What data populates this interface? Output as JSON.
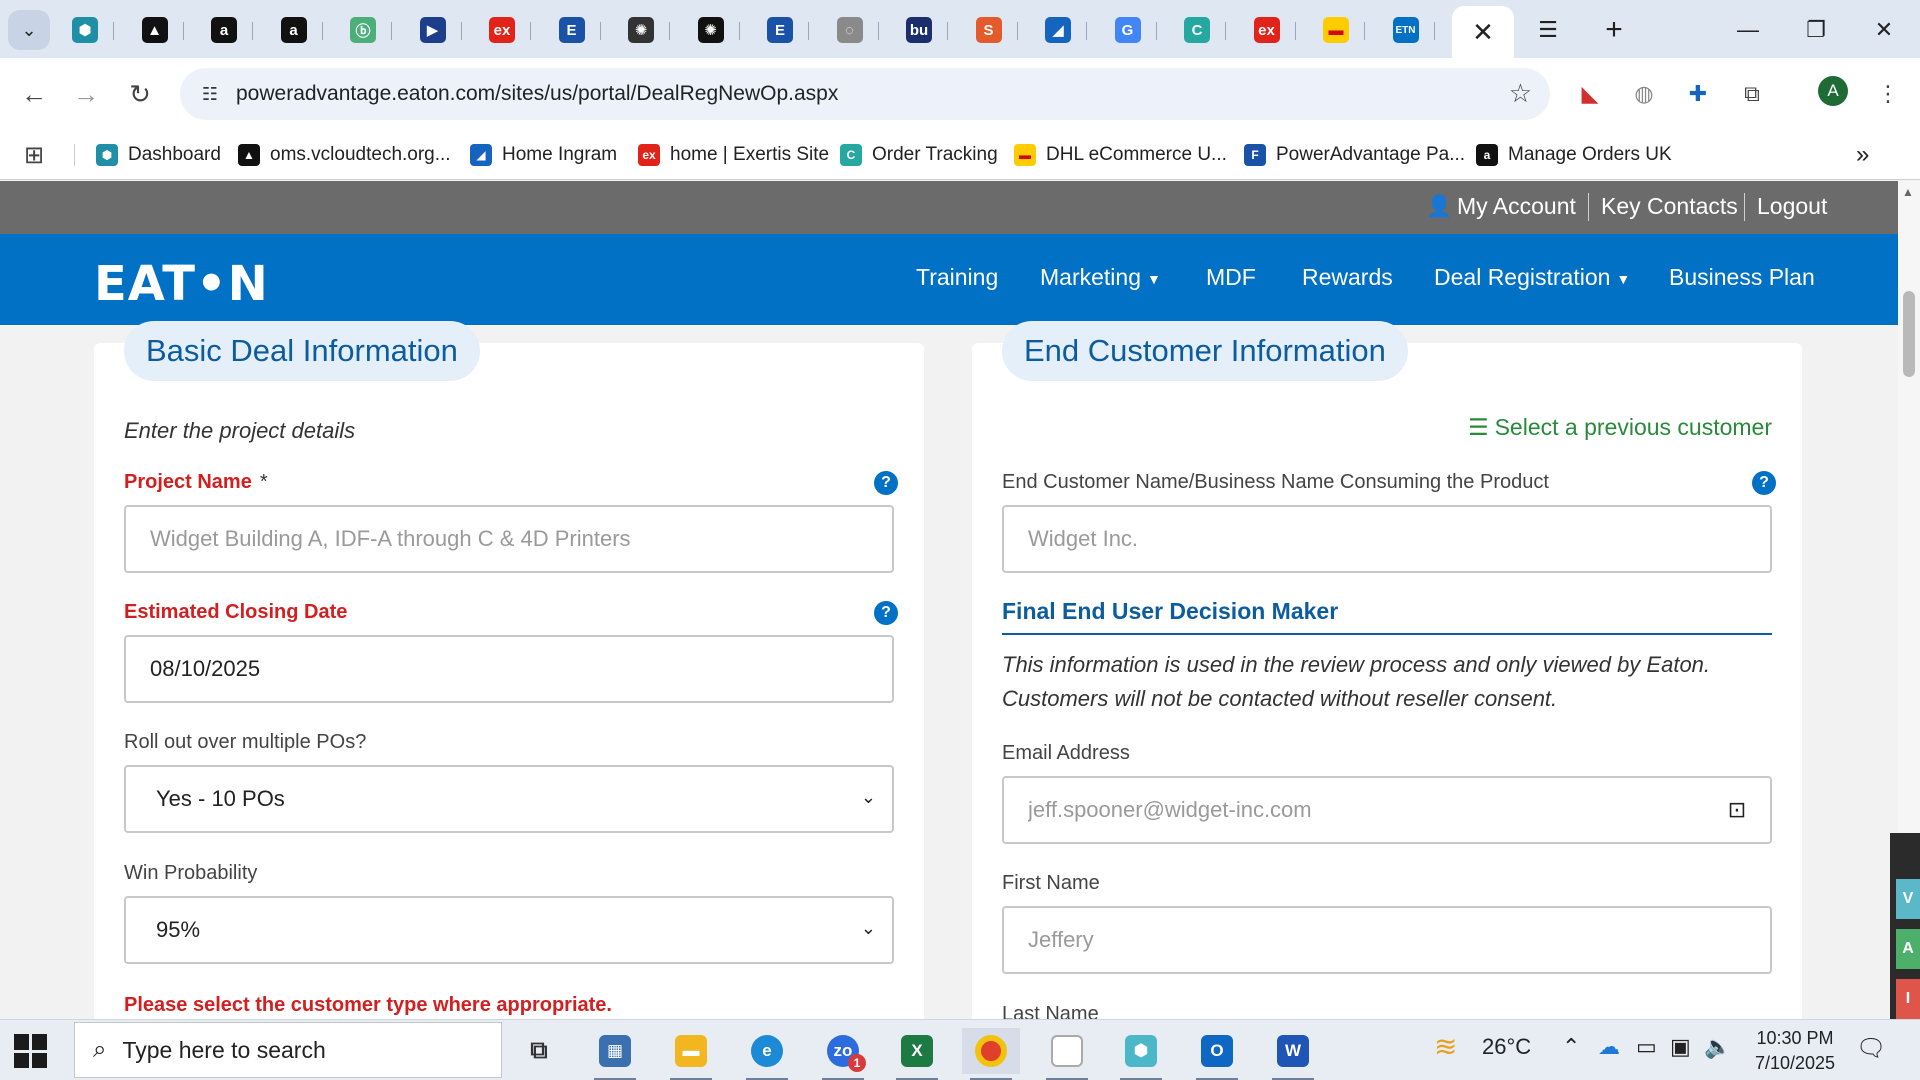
{
  "browser": {
    "active_tab_close": "✕",
    "pinned_tabs": [
      {
        "icon": "hexagon-icon",
        "glyph": "⬢",
        "color": "#1f8fa8",
        "text_color": "#ffffff"
      },
      {
        "icon": "triangle-logo-icon",
        "glyph": "▲",
        "color": "#111111",
        "text_color": "#ffffff"
      },
      {
        "icon": "amazon-icon",
        "glyph": "a",
        "color": "#111111",
        "text_color": "#ffffff"
      },
      {
        "icon": "amazon-icon",
        "glyph": "a",
        "color": "#111111",
        "text_color": "#ffffff"
      },
      {
        "icon": "green-bolt-icon",
        "glyph": "ⓑ",
        "color": "#4caf7a",
        "text_color": "#ffffff"
      },
      {
        "icon": "arrow-play-icon",
        "glyph": "▶",
        "color": "#1d3e8a",
        "text_color": "#ffffff"
      },
      {
        "icon": "exertis-icon",
        "glyph": "ex",
        "color": "#e2231a",
        "text_color": "#ffffff"
      },
      {
        "icon": "e-logo-icon",
        "glyph": "E",
        "color": "#1a52a8",
        "text_color": "#ffffff"
      },
      {
        "icon": "openai-icon",
        "glyph": "✺",
        "color": "#333333",
        "text_color": "#ffffff"
      },
      {
        "icon": "openai-icon",
        "glyph": "✺",
        "color": "#111111",
        "text_color": "#ffffff"
      },
      {
        "icon": "e-logo-icon",
        "glyph": "E",
        "color": "#1a52a8",
        "text_color": "#ffffff"
      },
      {
        "icon": "lightbulb-icon",
        "glyph": "◌",
        "color": "#8a8a8a",
        "text_color": "#ffffff"
      },
      {
        "icon": "bu-logo-icon",
        "glyph": "bu",
        "color": "#1a2f6b",
        "text_color": "#ffffff"
      },
      {
        "icon": "stack-logo-icon",
        "glyph": "S",
        "color": "#e45a2a",
        "text_color": "#ffffff"
      },
      {
        "icon": "ingram-icon",
        "glyph": "◢",
        "color": "#1565c0",
        "text_color": "#ffffff"
      },
      {
        "icon": "google-icon",
        "glyph": "G",
        "color": "#4285f4",
        "text_color": "#ffffff"
      },
      {
        "icon": "order-tracking-icon",
        "glyph": "C",
        "color": "#24a8a0",
        "text_color": "#ffffff"
      },
      {
        "icon": "exertis-icon",
        "glyph": "ex",
        "color": "#e2231a",
        "text_color": "#ffffff"
      },
      {
        "icon": "dhl-icon",
        "glyph": "▬",
        "color": "#ffcc00",
        "text_color": "#d40511"
      },
      {
        "icon": "eaton-icon",
        "glyph": "ETN",
        "color": "#0071c5",
        "text_color": "#ffffff"
      }
    ],
    "tabs_menu_icon": "☰",
    "new_tab": "+",
    "window_controls": {
      "minimize": "—",
      "restore": "❐",
      "close": "✕"
    },
    "url": "poweradvantage.eaton.com/sites/us/portal/DealRegNewOp.aspx",
    "avatar_letter": "A",
    "bookmarks": [
      {
        "label": "Dashboard",
        "icon": "hexagon-icon",
        "glyph": "⬢",
        "color": "#1f8fa8"
      },
      {
        "label": "oms.vcloudtech.org...",
        "icon": "triangle-logo-icon",
        "glyph": "▲",
        "color": "#111111"
      },
      {
        "label": "Home Ingram",
        "icon": "ingram-icon",
        "glyph": "◢",
        "color": "#1565c0"
      },
      {
        "label": "home | Exertis Site",
        "icon": "exertis-icon",
        "glyph": "ex",
        "color": "#e2231a"
      },
      {
        "label": "Order Tracking",
        "icon": "order-tracking-icon",
        "glyph": "C",
        "color": "#24a8a0"
      },
      {
        "label": "DHL eCommerce U...",
        "icon": "dhl-icon",
        "glyph": "▬",
        "color": "#ffcc00"
      },
      {
        "label": "PowerAdvantage Pa...",
        "icon": "document-icon",
        "glyph": "F",
        "color": "#1a52a8"
      },
      {
        "label": "Manage Orders UK",
        "icon": "amazon-icon",
        "glyph": "a",
        "color": "#111111"
      }
    ],
    "bookmarks_overflow": "»"
  },
  "site": {
    "utility": {
      "my_account": "My Account",
      "key_contacts": "Key Contacts",
      "logout": "Logout"
    },
    "logo": "EAT•N",
    "nav": {
      "training": "Training",
      "marketing": "Marketing",
      "mdf": "MDF",
      "rewards": "Rewards",
      "deal_registration": "Deal Registration",
      "business_plan": "Business Plan"
    }
  },
  "basic": {
    "title": "Basic Deal Information",
    "intro": "Enter the project details",
    "project_name_label": "Project Name",
    "required_mark": "*",
    "project_name_placeholder": "Widget Building A, IDF-A through C & 4D Printers",
    "closing_date_label": "Estimated Closing Date",
    "closing_date_value": "08/10/2025",
    "rollout_label": "Roll out over multiple POs?",
    "rollout_value": "Yes - 10 POs",
    "win_prob_label": "Win Probability",
    "win_prob_value": "95%",
    "warning": "Please select the customer type where appropriate."
  },
  "end_customer": {
    "title": "End Customer Information",
    "select_previous": "Select a previous customer",
    "name_label": "End Customer Name/Business Name Consuming the Product",
    "name_placeholder": "Widget Inc.",
    "decision_maker_title": "Final End User Decision Maker",
    "disclaimer": "This information is used in the review process and only viewed by Eaton. Customers will not be contacted without reseller consent.",
    "email_label": "Email Address",
    "email_placeholder": "jeff.spooner@widget-inc.com",
    "first_name_label": "First Name",
    "first_name_placeholder": "Jeffery",
    "last_name_label": "Last Name"
  },
  "side_tabs": [
    {
      "letter": "V",
      "color": "#5bb8c9"
    },
    {
      "letter": "A",
      "color": "#4caf6a"
    },
    {
      "letter": "I",
      "color": "#e0554a"
    }
  ],
  "taskbar": {
    "search_placeholder": "Type here to search",
    "zoom_badge": "1",
    "temperature": "26°C",
    "time": "10:30 PM",
    "date": "7/10/2025"
  }
}
